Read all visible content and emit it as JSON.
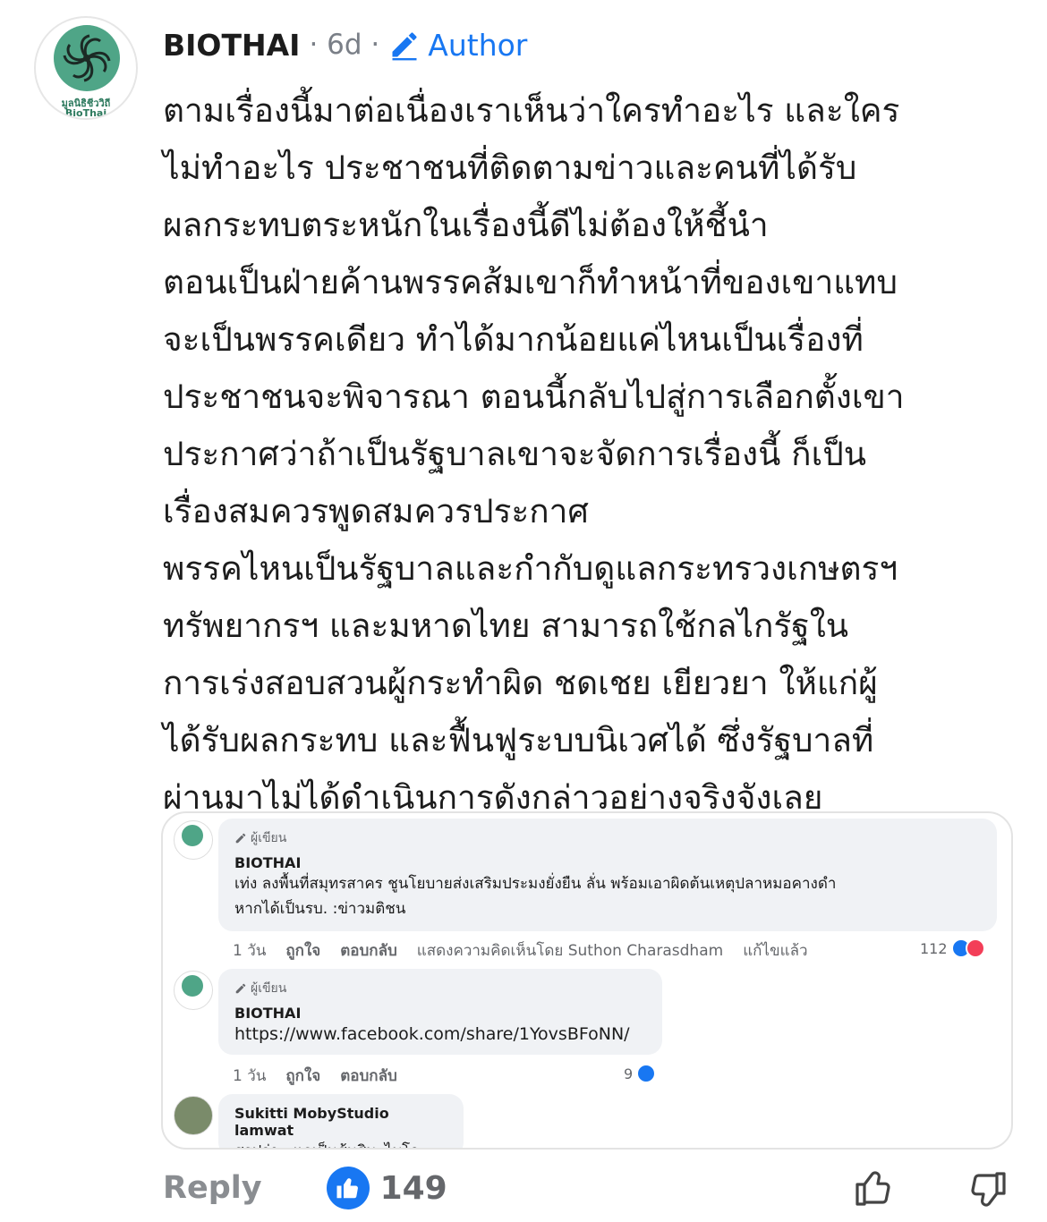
{
  "comment": {
    "author": "BIOTHAI",
    "time": "· 6d ·",
    "badge": "Author",
    "avatar_text_th": "มูลนิธิชีววิถี",
    "avatar_text_en": "BioThai",
    "lines": [
      "ตามเรื่องนี้มาต่อเนื่องเราเห็นว่าใครทำอะไร และใคร",
      "ไม่ทำอะไร ประชาชนที่ติดตามข่าวและคนที่ได้รับ",
      "ผลกระทบตระหนักในเรื่องนี้ดีไม่ต้องให้ชี้นำ",
      "ตอนเป็นฝ่ายค้านพรรคส้มเขาก็ทำหน้าที่ของเขาแทบ",
      "จะเป็นพรรคเดียว ทำได้มากน้อยแค่ไหนเป็นเรื่องที่",
      "ประชาชนจะพิจารณา ตอนนี้กลับไปสู่การเลือกตั้งเขา",
      "ประกาศว่าถ้าเป็นรัฐบาลเขาจะจัดการเรื่องนี้ ก็เป็น",
      "เรื่องสมควรพูดสมควรประกาศ",
      "พรรคไหนเป็นรัฐบาลและกำกับดูแลกระทรวงเกษตรฯ",
      "ทรัพยากรฯ และมหาดไทย สามารถใช้กลไกรัฐใน",
      "การเร่งสอบสวนผู้กระทำผิด ชดเชย เยียวยา ให้แก่ผู้",
      "ได้รับผลกระทบ และฟื้นฟูระบบนิเวศได้ ซึ่งรัฐบาลที่",
      "ผ่านมาไม่ได้ดำเนินการดังกล่าวอย่างจริงจังเลย"
    ]
  },
  "screenshot": {
    "c1": {
      "tag": "ผู้เขียน",
      "name": "BIOTHAI",
      "text1": "เท่ง ลงพื้นที่สมุทรสาคร ชูนโยบายส่งเสริมประมงยั่งยืน ลั่น พร้อมเอาผิดต้นเหตุปลาหมอคางดำ",
      "text2": "หากได้เป็นรบ. :ข่าวมติชน",
      "time": "1 วัน",
      "like": "ถูกใจ",
      "reply": "ตอบกลับ",
      "shown_by": "แสดงความคิดเห็นโดย Suthon Charasdham",
      "edited": "แก้ไขแล้ว",
      "count": "112"
    },
    "c2": {
      "tag": "ผู้เขียน",
      "name": "BIOTHAI",
      "text": "https://www.facebook.com/share/1YovsBFoNN/",
      "time": "1 วัน",
      "like": "ถูกใจ",
      "reply": "ตอบกลับ",
      "count": "9"
    },
    "c3": {
      "name": "Sukitti MobyStudio lamwat",
      "text": "สรุปว่า...แกเป็นส้มสินะไบโอ"
    }
  },
  "footer": {
    "reply": "Reply",
    "likes": "149"
  },
  "colors": {
    "accent": "#1877f2",
    "brand_green": "#4fa587",
    "meta_gray": "#7a7f87"
  },
  "icons": [
    "pencil-icon",
    "like-icon",
    "thumbs-up-icon",
    "thumbs-down-icon",
    "love-icon"
  ]
}
